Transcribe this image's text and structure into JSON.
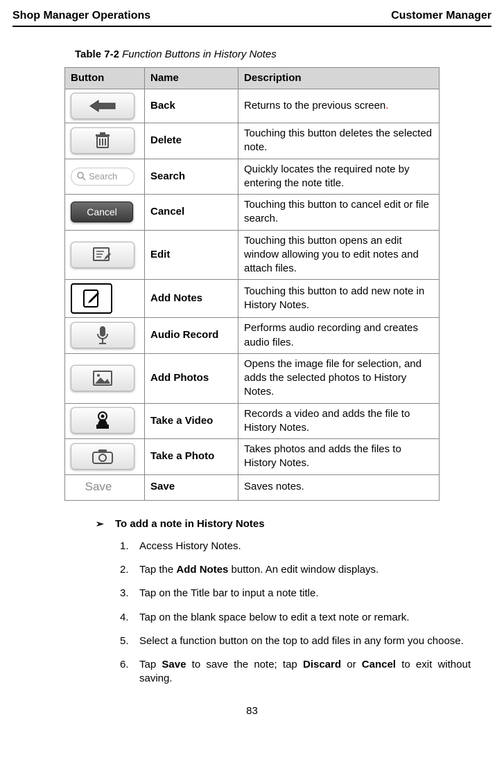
{
  "header": {
    "left": "Shop Manager Operations",
    "right": "Customer Manager"
  },
  "table_caption": {
    "num": "Table 7-2",
    "title": "Function Buttons in History Notes"
  },
  "table_headers": {
    "button": "Button",
    "name": "Name",
    "description": "Description"
  },
  "rows": [
    {
      "name": "Back",
      "desc_a": "Returns to the previous screen",
      "desc_b": "."
    },
    {
      "name": "Delete",
      "desc": "Touching this button deletes the selected note."
    },
    {
      "name": "Search",
      "desc": "Quickly locates the required note by entering the note title.",
      "search_label": "Search"
    },
    {
      "name": "Cancel",
      "desc": "Touching this button to cancel edit or file search.",
      "cancel_label": "Cancel"
    },
    {
      "name": "Edit",
      "desc": "Touching this button opens an edit window allowing you to edit notes and attach files."
    },
    {
      "name": "Add Notes",
      "desc": "Touching this button to add new note in History Notes."
    },
    {
      "name": "Audio Record",
      "desc": "Performs audio recording and creates audio files."
    },
    {
      "name": "Add Photos",
      "desc": "Opens the image file for selection, and adds the selected photos to History Notes."
    },
    {
      "name": "Take a Video",
      "desc": "Records a video and adds the file to History Notes."
    },
    {
      "name": "Take a Photo",
      "desc": "Takes photos and adds the files to History Notes."
    },
    {
      "name": "Save",
      "desc": "Saves notes.",
      "save_label": "Save"
    }
  ],
  "procedure": {
    "title": "To add a note in History Notes"
  },
  "steps": {
    "s1": "Access History Notes.",
    "s2a": "Tap the ",
    "s2b": "Add Notes",
    "s2c": " button. An edit window displays.",
    "s3": "Tap on the Title bar to input a note title.",
    "s4": "Tap on the blank space below to edit a text note or remark.",
    "s5": "Select a function button on the top to add files in any form you choose.",
    "s6a": "Tap ",
    "s6b": "Save",
    "s6c": " to save the note; tap ",
    "s6d": "Discard",
    "s6e": " or ",
    "s6f": "Cancel",
    "s6g": " to exit without saving."
  },
  "page_number": "83"
}
